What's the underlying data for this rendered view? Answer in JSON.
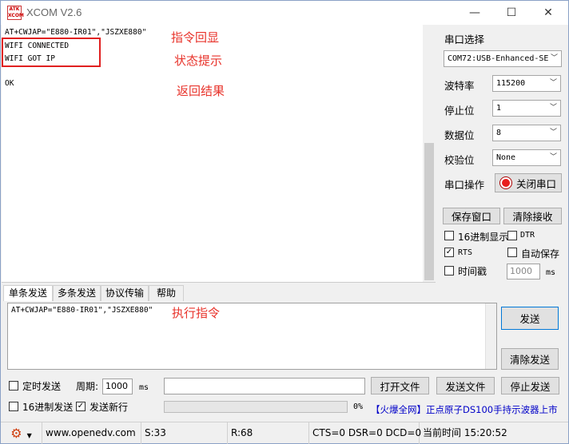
{
  "window": {
    "title": "XCOM V2.6",
    "icon_text": "ATK XCOM",
    "minimize": "—",
    "maximize": "☐",
    "close": "✕"
  },
  "receive": {
    "lines": [
      "AT+CWJAP=\"E880-IR01\",\"JSZXE880\"",
      "WIFI CONNECTED",
      "WIFI GOT IP",
      "",
      "OK"
    ],
    "annotations": [
      "指令回显",
      "状态提示",
      "返回结果"
    ]
  },
  "panel": {
    "port_label": "串口选择",
    "port_value": "COM72:USB-Enhanced-SE",
    "baud_label": "波特率",
    "baud_value": "115200",
    "stop_label": "停止位",
    "stop_value": "1",
    "data_label": "数据位",
    "data_value": "8",
    "parity_label": "校验位",
    "parity_value": "None",
    "op_label": "串口操作",
    "close_port_button": "关闭串口",
    "save_window_button": "保存窗口",
    "clear_receive_button": "清除接收",
    "hex_display_label": "16进制显示",
    "dtr_label": "DTR",
    "rts_label": "RTS",
    "auto_save_label": "自动保存",
    "timestamp_label": "时间戳",
    "timestamp_value": "1000",
    "timestamp_unit": "ms",
    "colors": {
      "red_indicator": "#e81e1e",
      "annotation": "#e8332b"
    }
  },
  "tabs": [
    "单条发送",
    "多条发送",
    "协议传输",
    "帮助"
  ],
  "send": {
    "text": "AT+CWJAP=\"E880-IR01\",\"JSZXE880\"",
    "annotation": "执行指令",
    "send_button": "发送",
    "clear_send_button": "清除发送",
    "timed_send_label": "定时发送",
    "period_label": "周期:",
    "period_value": "1000",
    "period_unit": "ms",
    "open_file_button": "打开文件",
    "send_file_button": "发送文件",
    "stop_send_button": "停止发送",
    "hex_send_label": "16进制发送",
    "send_newline_label": "发送新行",
    "progress_percent": "0%",
    "ad_text": "【火爆全网】正点原子DS100手持示波器上市"
  },
  "statusbar": {
    "url": "www.openedv.com",
    "sent": "S:33",
    "received": "R:68",
    "lines_status": "CTS=0 DSR=0 DCD=0",
    "time": "当前时间 15:20:52"
  }
}
